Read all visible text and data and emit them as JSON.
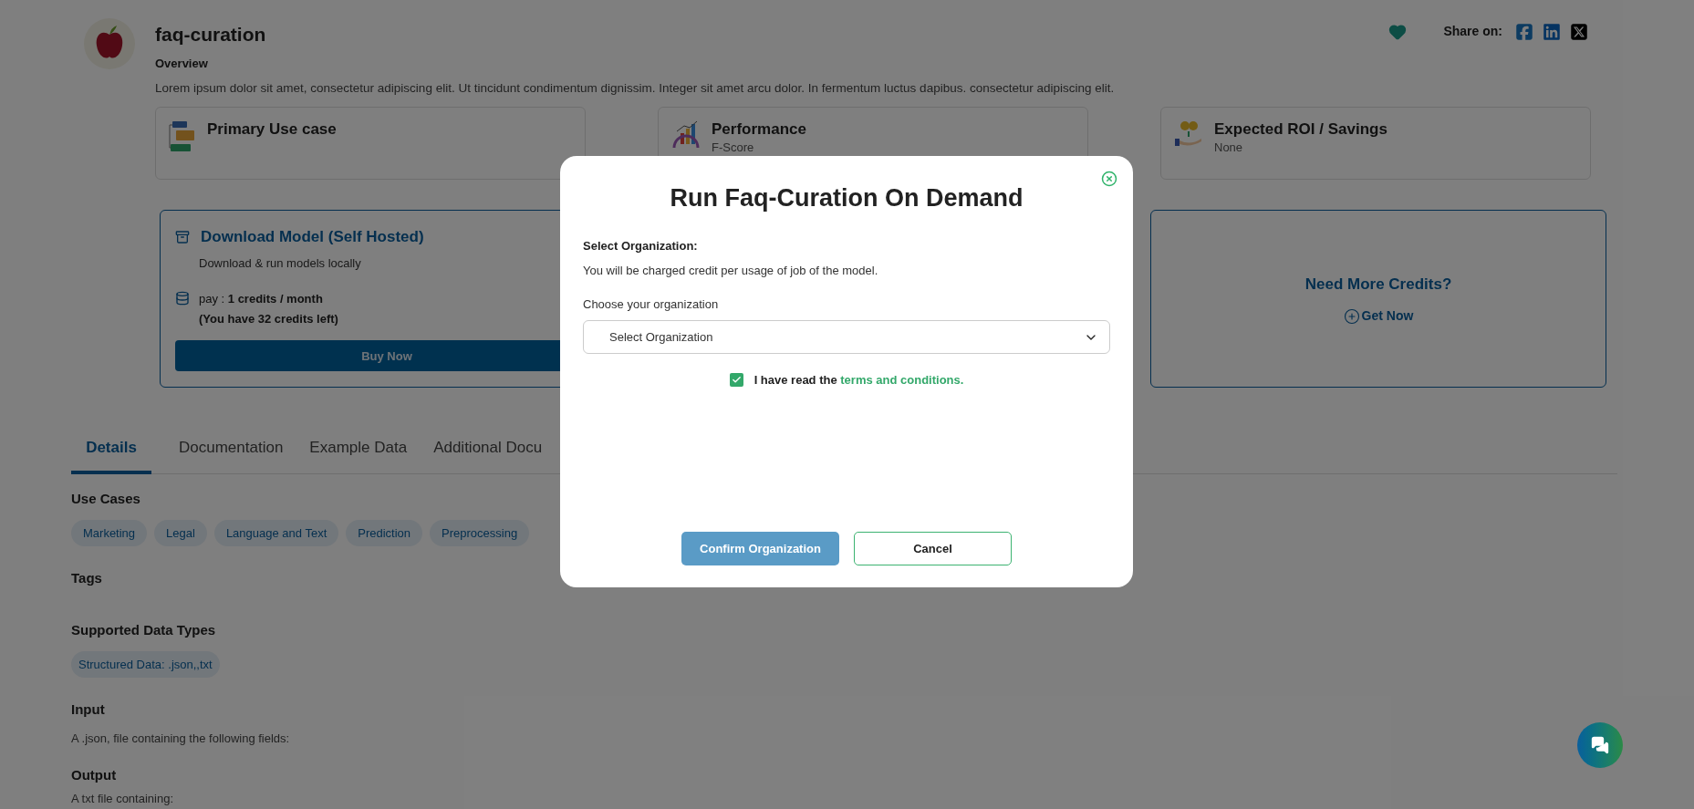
{
  "header": {
    "title": "faq-curation",
    "overview_label": "Overview",
    "description": "Lorem ipsum dolor sit amet, consectetur adipiscing elit. Ut tincidunt condimentum dignissim. Integer sit amet arcu dolor. In fermentum luctus dapibus. consectetur adipiscing elit.",
    "favorited": true,
    "share_label": "Share on:"
  },
  "info_cards": [
    {
      "kind": "use_case",
      "title": "Primary Use case"
    },
    {
      "kind": "performance",
      "title": "Performance",
      "value": "F-Score"
    },
    {
      "kind": "roi",
      "title": "Expected ROI / Savings",
      "value": "None"
    }
  ],
  "download_card": {
    "title": "Download Model (Self Hosted)",
    "subtitle": "Download & run models locally",
    "price": "pay : **1 credits / month**",
    "balance": "(You have 32 credits left)",
    "button": "Buy Now"
  },
  "credits_card": {
    "title": "Need More Credits?",
    "link": "Get Now"
  },
  "tabs": [
    {
      "label": "Details",
      "selected": true
    },
    {
      "label": "Documentation",
      "selected": false
    },
    {
      "label": "Example Data",
      "selected": false
    },
    {
      "label": "Additional Docu",
      "selected": false
    }
  ],
  "details": {
    "use_cases_heading": "Use Cases",
    "use_cases": [
      "Marketing",
      "Legal",
      "Language and Text",
      "Prediction",
      "Preprocessing"
    ],
    "tags_heading": "Tags",
    "data_types_heading": "Supported Data Types",
    "data_types": [
      "Structured Data: .json,,txt"
    ],
    "input_heading": "Input",
    "input_text": "A .json, file containing the following fields:",
    "output_heading": "Output",
    "output_text": "A txt file containing:"
  },
  "modal": {
    "title": "Run Faq-Curation On Demand",
    "section_label": "Select Organization:",
    "note": "You will be charged credit per usage of job of the model.",
    "field_label": "Choose your organization",
    "select_placeholder": "Select Organization",
    "agree": {
      "checked": true,
      "text": "I have read the ",
      "link": "terms and conditions."
    },
    "buttons": [
      {
        "label": "Confirm Organization",
        "kind": "primary"
      },
      {
        "label": "Cancel",
        "kind": "secondary"
      }
    ]
  }
}
